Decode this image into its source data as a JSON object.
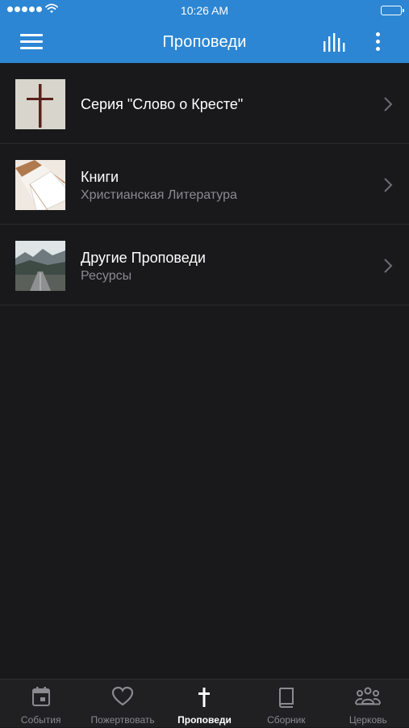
{
  "status_bar": {
    "time": "10:26 AM"
  },
  "header": {
    "title": "Проповеди"
  },
  "list": [
    {
      "title": "Серия \"Слово о Кресте\"",
      "subtitle": ""
    },
    {
      "title": "Книги",
      "subtitle": "Христианская Литература"
    },
    {
      "title": "Другие Проповеди",
      "subtitle": "Ресурсы"
    }
  ],
  "tabs": [
    {
      "label": "События",
      "icon": "calendar-icon"
    },
    {
      "label": "Пожертвовать",
      "icon": "heart-icon"
    },
    {
      "label": "Проповеди",
      "icon": "cross-icon",
      "active": true
    },
    {
      "label": "Сборник",
      "icon": "book-icon"
    },
    {
      "label": "Церковь",
      "icon": "people-icon"
    }
  ],
  "colors": {
    "header": "#2c86d3",
    "background": "#19191b",
    "tabbar": "#202023",
    "muted_text": "#8b8b90"
  }
}
